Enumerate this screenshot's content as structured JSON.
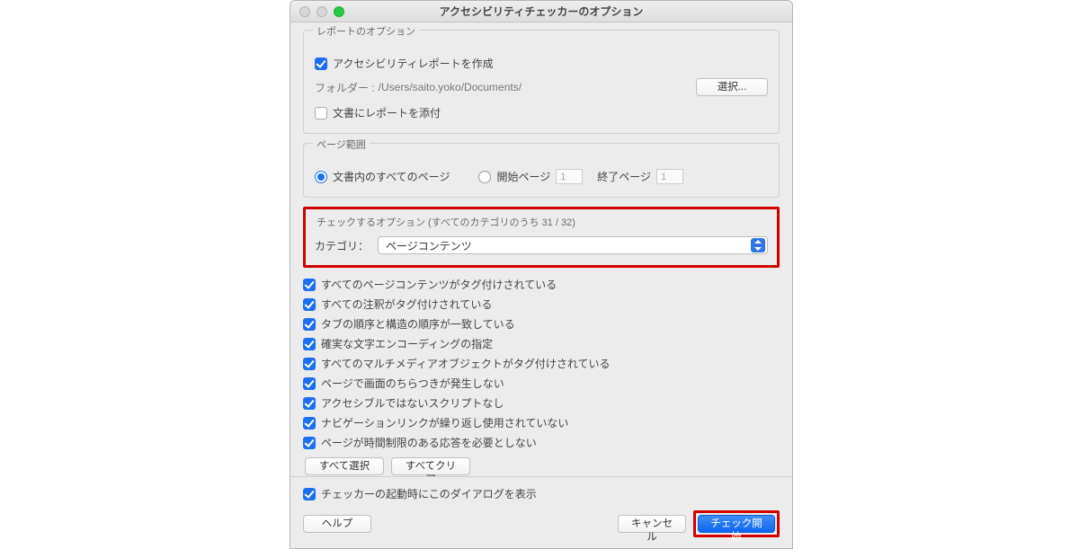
{
  "title": "アクセシビリティチェッカーのオプション",
  "report_options": {
    "group_title": "レポートのオプション",
    "create_report_label": "アクセシビリティレポートを作成",
    "folder_label": "フォルダー :",
    "folder_path": "/Users/saito.yoko/Documents/",
    "select_button": "選択...",
    "attach_report_label": "文書にレポートを添付"
  },
  "page_range": {
    "group_title": "ページ範囲",
    "all_pages_label": "文書内のすべてのページ",
    "from_page_label": "開始ページ",
    "from_value": "1",
    "to_label": "終了ページ",
    "to_value": "1"
  },
  "check_options": {
    "title": "チェックするオプション (すべてのカテゴリのうち 31 / 32)",
    "category_label": "カテゴリ：",
    "category_value": "ページコンテンツ"
  },
  "checks": [
    "すべてのページコンテンツがタグ付けされている",
    "すべての注釈がタグ付けされている",
    "タブの順序と構造の順序が一致している",
    "確実な文字エンコーディングの指定",
    "すべてのマルチメディアオブジェクトがタグ付けされている",
    "ページで画面のちらつきが発生しない",
    "アクセシブルではないスクリプトなし",
    "ナビゲーションリンクが繰り返し使用されていない",
    "ページが時間制限のある応答を必要としない"
  ],
  "buttons": {
    "select_all": "すべて選択",
    "clear_all": "すべてクリア",
    "show_on_start": "チェッカーの起動時にこのダイアログを表示",
    "help": "ヘルプ",
    "cancel": "キャンセル",
    "start": "チェック開始"
  }
}
